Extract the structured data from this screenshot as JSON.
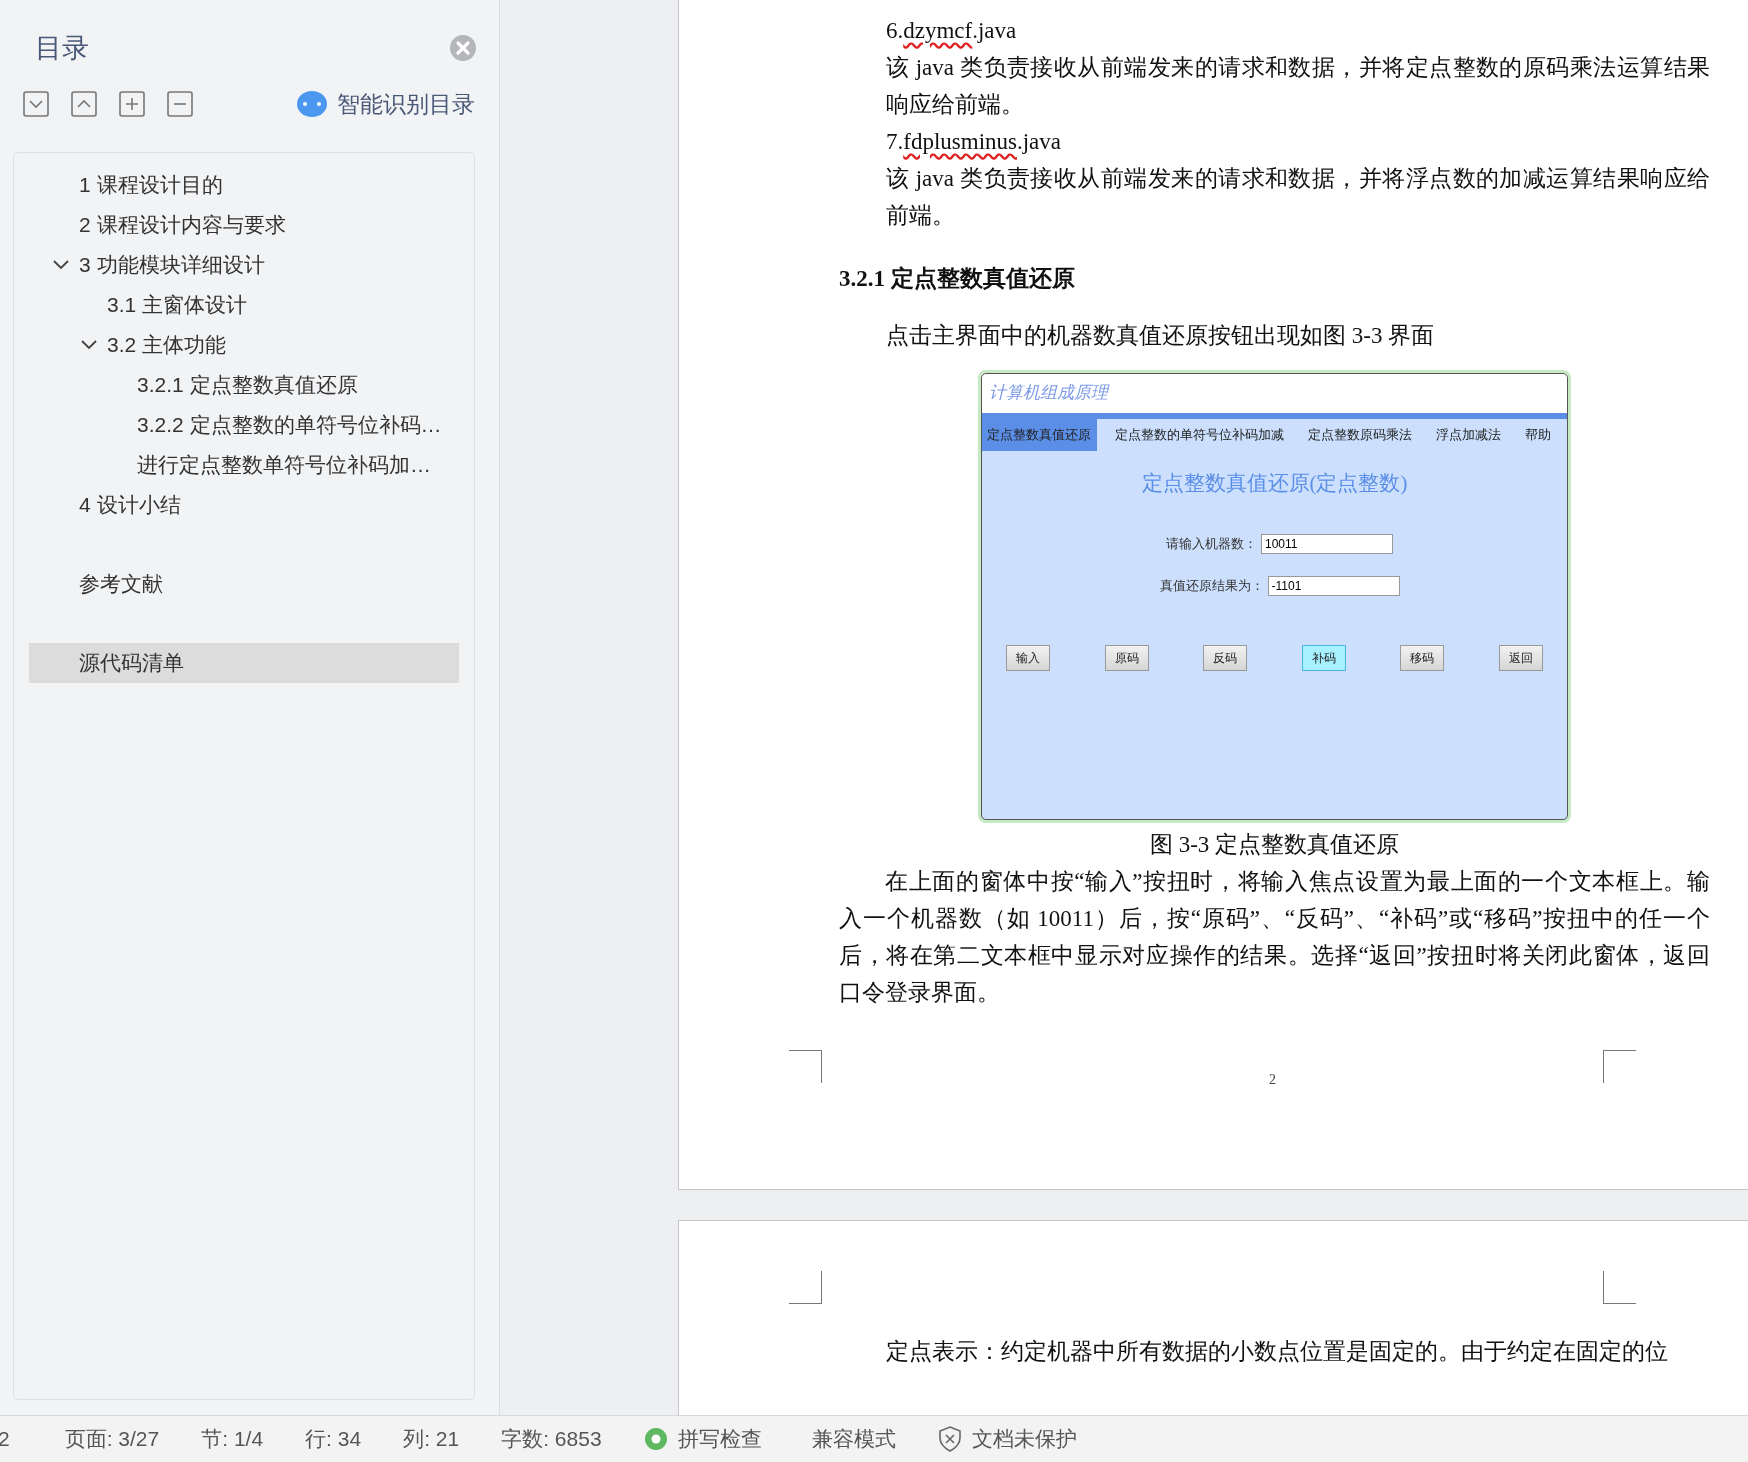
{
  "sidebar": {
    "title": "目录",
    "toolbar": [
      {
        "kind": "expand"
      },
      {
        "kind": "collapse"
      },
      {
        "kind": "add"
      },
      {
        "kind": "remove"
      }
    ],
    "smart_button": "智能识别目录",
    "toc": [
      {
        "label": "1  课程设计目的",
        "selected": false,
        "kind": "chapter"
      },
      {
        "label": "2  课程设计内容与要求",
        "selected": false,
        "kind": "chapter"
      },
      {
        "label": "3  功能模块详细设计",
        "selected": false,
        "kind": "chapter",
        "expanded": true,
        "children": [
          {
            "label": "3.1  主窗体设计",
            "selected": false,
            "kind": "chapter"
          },
          {
            "label": "3.2   主体功能",
            "selected": false,
            "kind": "chapter",
            "expanded": true,
            "children": [
              {
                "label": "3.2.1 定点整数真值还原",
                "selected": false,
                "kind": "chapter"
              },
              {
                "label": "3.2.2 定点整数的单符号位补码…",
                "selected": false,
                "kind": "chapter"
              },
              {
                "label": "进行定点整数单符号位补码加…",
                "selected": false,
                "kind": "chapter"
              }
            ]
          }
        ]
      },
      {
        "label": "4  设计小结",
        "selected": false,
        "kind": "chapter"
      },
      {
        "label": "参考文献",
        "selected": false,
        "kind": "back_matter"
      },
      {
        "label": "源代码清单",
        "selected": true,
        "kind": "back_matter"
      }
    ]
  },
  "page_1": {
    "blocks": [
      {
        "kind": "file",
        "prefix": "6.",
        "word": "dzymcf",
        "suffix": ".java",
        "misspelled": true
      },
      {
        "kind": "desc",
        "text": " 该 java 类负责接收从前端发来的请求和数据，并将定点整数的原码乘法运算结果响应给前端。"
      },
      {
        "kind": "file",
        "prefix": "7.",
        "word": "fdplusminus",
        "suffix": ".java",
        "misspelled": true
      },
      {
        "kind": "desc",
        "text": " 该 java 类负责接收从前端发来的请求和数据，并将浮点数的加减运算结果响应给前端。"
      },
      {
        "kind": "heading",
        "text": "3.2.1 定点整数真值还原"
      },
      {
        "kind": "desc",
        "text": "点击主界面中的机器数真值还原按钮出现如图 3-3 界面"
      },
      {
        "kind": "figure"
      },
      {
        "kind": "caption",
        "text": "图 3-3 定点整数真值还原"
      },
      {
        "kind": "para",
        "text": "在上面的窗体中按“输入”按扭时，将输入焦点设置为最上面的一个文本框上。输入一个机器数（如 10011）后，按“原码”、“反码”、“补码”或“移码”按扭中的任一个后，将在第二文本框中显示对应操作的结果。选择“返回”按扭时将关闭此窗体，返回口令登录界面。"
      }
    ],
    "page_number": "2"
  },
  "figure_app": {
    "title": "计算机组成原理",
    "tabs": [
      {
        "label": "定点整数真值还原",
        "selected": true
      },
      {
        "label": "定点整数的单符号位补码加减",
        "selected": false
      },
      {
        "label": "定点整数原码乘法",
        "selected": false
      },
      {
        "label": "浮点加减法",
        "selected": false
      },
      {
        "label": "帮助",
        "selected": false
      }
    ],
    "heading": "定点整数真值还原(定点整数)",
    "fields": [
      {
        "label": "请输入机器数：",
        "value": "10011"
      },
      {
        "label": "真值还原结果为：",
        "value": "-1101"
      }
    ],
    "buttons": [
      {
        "label": "输入",
        "selected": false
      },
      {
        "label": "原码",
        "selected": false
      },
      {
        "label": "反码",
        "selected": false
      },
      {
        "label": "补码",
        "selected": true
      },
      {
        "label": "移码",
        "selected": false
      },
      {
        "label": "返回",
        "selected": false
      }
    ]
  },
  "page_2": {
    "text": "定点表示：约定机器中所有数据的小数点位置是固定的。由于约定在固定的位"
  },
  "status_bar": {
    "items": [
      {
        "kind": "text",
        "text": "2"
      },
      {
        "kind": "text",
        "text": "页面: 3/27"
      },
      {
        "kind": "text",
        "text": "节: 1/4"
      },
      {
        "kind": "text",
        "text": "行: 34"
      },
      {
        "kind": "text",
        "text": "列: 21"
      },
      {
        "kind": "text",
        "text": "字数: 6853"
      },
      {
        "kind": "spell",
        "text": "拼写检查"
      },
      {
        "kind": "text",
        "text": "兼容模式"
      },
      {
        "kind": "protect",
        "text": "文档未保护"
      }
    ]
  }
}
